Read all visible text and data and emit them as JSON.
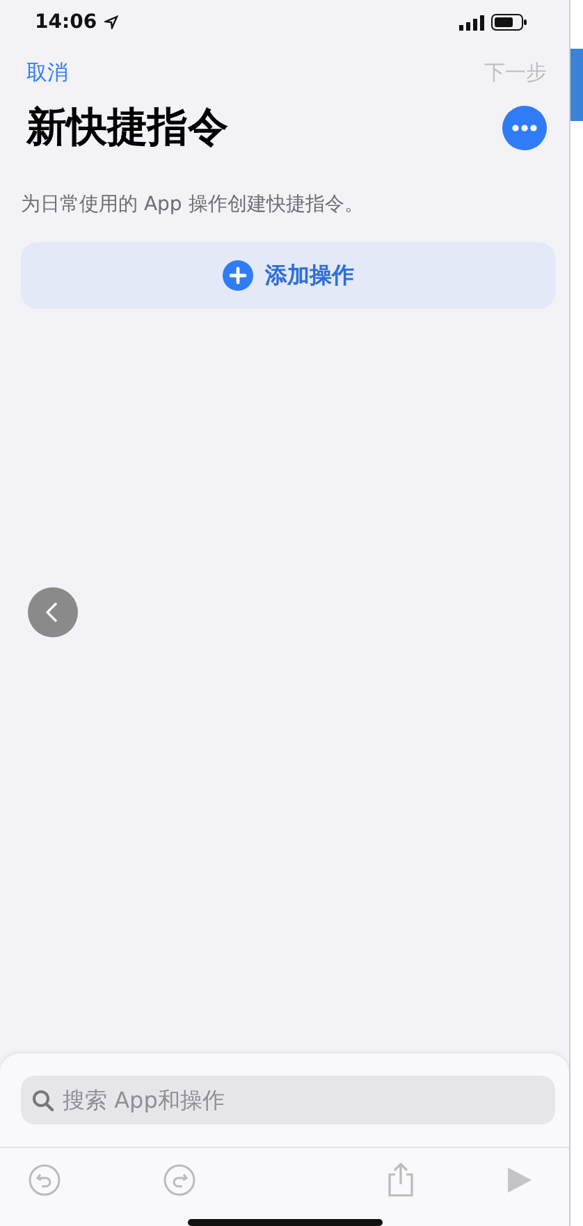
{
  "status_bar": {
    "time": "14:06"
  },
  "nav": {
    "cancel": "取消",
    "next": {
      "label": "下一步",
      "disabled": true
    }
  },
  "title": "新快捷指令",
  "description": "为日常使用的 App 操作创建快捷指令。",
  "add_action": {
    "label": "添加操作"
  },
  "search": {
    "placeholder": "搜索 App和操作"
  },
  "toolbar": {
    "play_disabled": true
  }
}
